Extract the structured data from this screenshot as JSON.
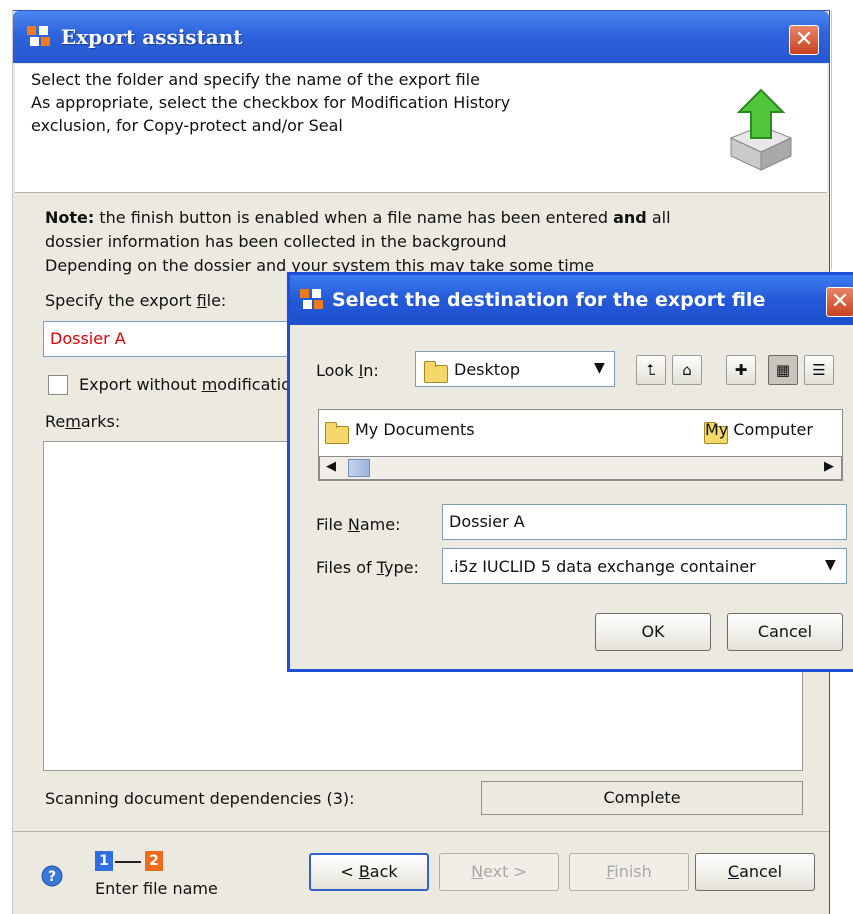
{
  "main_window": {
    "title": "Export assistant",
    "close_glyph": "✕",
    "header": {
      "lines": [
        "Select the folder and specify the name of the export file",
        "As appropriate, select the checkbox for Modification History",
        "exclusion, for Copy-protect and/or Seal"
      ],
      "icon": "export-tray-green-arrow-icon"
    },
    "note": {
      "bold_prefix": "Note:",
      "line1_a": " the finish button is enabled when a file name has been entered ",
      "line1_bold": "and",
      "line1_b": " all",
      "line2": "dossier information has been collected in the background",
      "line3": "Depending on the dossier and your system this may take some time"
    },
    "export_file": {
      "label_pre": "Specify the export ",
      "label_mn": "f",
      "label_post": "ile:",
      "value": "Dossier A",
      "value_color": "#e00000"
    },
    "checkbox": {
      "label_pre": "Export without ",
      "label_mn": "m",
      "label_post": "odification history",
      "checked": false
    },
    "remarks": {
      "label_pre": "Re",
      "label_mn": "m",
      "label_post": "arks:",
      "value": ""
    },
    "scanning": {
      "label": "Scanning document dependencies (3):",
      "status": "Complete"
    },
    "footer": {
      "steps": [
        "1",
        "2"
      ],
      "step_colors": [
        "#2f6fe0",
        "#f06a1c"
      ],
      "step_label": "Enter file name",
      "help_icon": "question-icon",
      "buttons": {
        "back_pre": "< ",
        "back_mn": "B",
        "back_post": "ack",
        "next_pre": "",
        "next_mn": "N",
        "next_post": "ext >",
        "finish_pre": "",
        "finish_mn": "F",
        "finish_post": "inish",
        "cancel_pre": "",
        "cancel_mn": "C",
        "cancel_post": "ancel"
      }
    }
  },
  "dialog": {
    "title": "Select the destination for the export file",
    "look_in": {
      "label_pre": "Look ",
      "label_mn": "I",
      "label_post": "n:",
      "value": "Desktop"
    },
    "toolbar_icons": [
      "up-folder-icon",
      "home-icon",
      "new-folder-icon",
      "list-view-icon",
      "details-view-icon"
    ],
    "list_items": [
      "My Documents",
      "My Computer"
    ],
    "file_name": {
      "label_pre": "File ",
      "label_mn": "N",
      "label_post": "ame:",
      "value": "Dossier A"
    },
    "file_type": {
      "label_pre": "Files of ",
      "label_mn": "T",
      "label_post": "ype:",
      "value": ".i5z IUCLID 5 data exchange container"
    },
    "ok_label": "OK",
    "cancel_label": "Cancel"
  }
}
